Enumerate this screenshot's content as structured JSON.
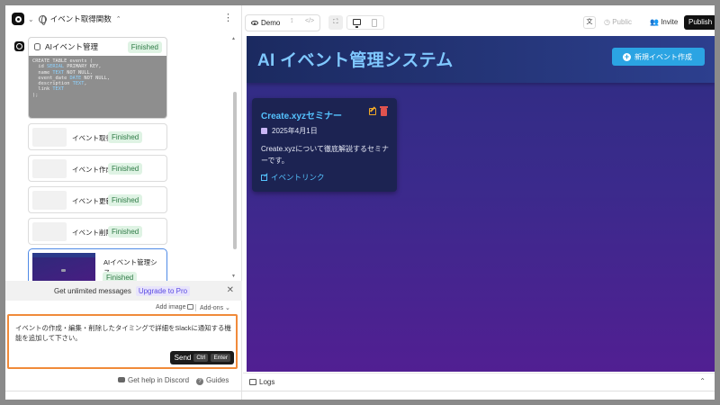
{
  "project": {
    "title": "イベント取得関数"
  },
  "chat": {
    "code_card": {
      "title": "AIイベント管理",
      "status": "Finished",
      "code": "CREATE TABLE events (\n  id SERIAL PRIMARY KEY,\n  name TEXT NOT NULL,\n  event_date DATE NOT NULL,\n  description TEXT,\n  link TEXT\n);"
    },
    "tasks": [
      {
        "label": "イベント取得",
        "status": "Finished"
      },
      {
        "label": "イベント作成",
        "status": "Finished"
      },
      {
        "label": "イベント更新",
        "status": "Finished"
      },
      {
        "label": "イベント削除",
        "status": "Finished"
      }
    ],
    "active_task": {
      "label": "AIイベント管理シス...",
      "status": "Finished"
    }
  },
  "upsell": {
    "text": "Get unlimited messages",
    "link": "Upgrade to Pro"
  },
  "composer": {
    "add_image": "Add image",
    "add_ons": "Add-ons",
    "prompt": "イベントの作成・編集・削除したタイミングで詳細をSlackに通知する機能を追加して下さい。",
    "send": "Send",
    "key_ctrl": "Ctrl",
    "key_enter": "Enter"
  },
  "footer": {
    "discord": "Get help in Discord",
    "guides": "Guides"
  },
  "toolbar": {
    "demo": "Demo",
    "code_icon": "</>",
    "expand_icon": "⛶",
    "public": "Public",
    "invite": "Invite",
    "publish": "Publish"
  },
  "preview": {
    "app_title": "AI イベント管理システム",
    "new_event_button": "新規イベント作成",
    "event": {
      "title": "Create.xyzセミナー",
      "date": "2025年4月1日",
      "description": "Create.xyzについて徹底解説するセミナーです。",
      "link": "イベントリンク"
    }
  },
  "logs": {
    "label": "Logs"
  },
  "colors": {
    "accent_blue": "#2ba4e3",
    "finished_badge": "#dff3e4",
    "prompt_border": "#f08a3a",
    "upgrade_link": "#5a4ae3"
  }
}
